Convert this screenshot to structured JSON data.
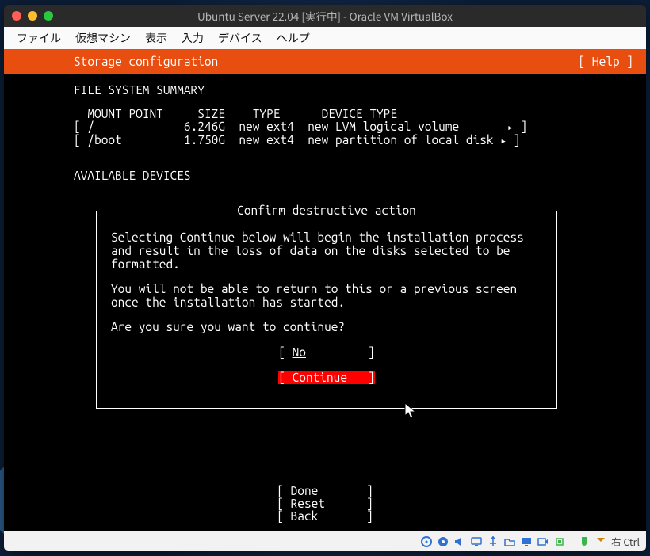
{
  "window": {
    "title": "Ubuntu Server 22.04 [実行中] - Oracle VM VirtualBox"
  },
  "menubar": {
    "items": [
      "ファイル",
      "仮想マシン",
      "表示",
      "入力",
      "デバイス",
      "ヘルプ"
    ]
  },
  "header": {
    "title": "Storage configuration",
    "help": "[ Help ]"
  },
  "fs_summary": {
    "title": "FILE SYSTEM SUMMARY",
    "columns": {
      "mount": "MOUNT POINT",
      "size": "SIZE",
      "type": "TYPE",
      "device": "DEVICE TYPE"
    },
    "rows": [
      {
        "mount": "/",
        "size": "6.246G",
        "type": "new ext4",
        "device": "new LVM logical volume"
      },
      {
        "mount": "/boot",
        "size": "1.750G",
        "type": "new ext4",
        "device": "new partition of local disk"
      }
    ]
  },
  "available": {
    "title": "AVAILABLE DEVICES"
  },
  "dialog": {
    "title": "Confirm destructive action",
    "para1": "Selecting Continue below will begin the installation process and result in the loss of data on the disks selected to be formatted.",
    "para2": "You will not be able to return to this or a previous screen once the installation has started.",
    "para3": "Are you sure you want to continue?",
    "no_label": "No",
    "continue_label": "Continue"
  },
  "bottom": {
    "done": "Done",
    "reset": "Reset",
    "back": "Back"
  },
  "statusbar": {
    "hostkey": "右 Ctrl"
  }
}
